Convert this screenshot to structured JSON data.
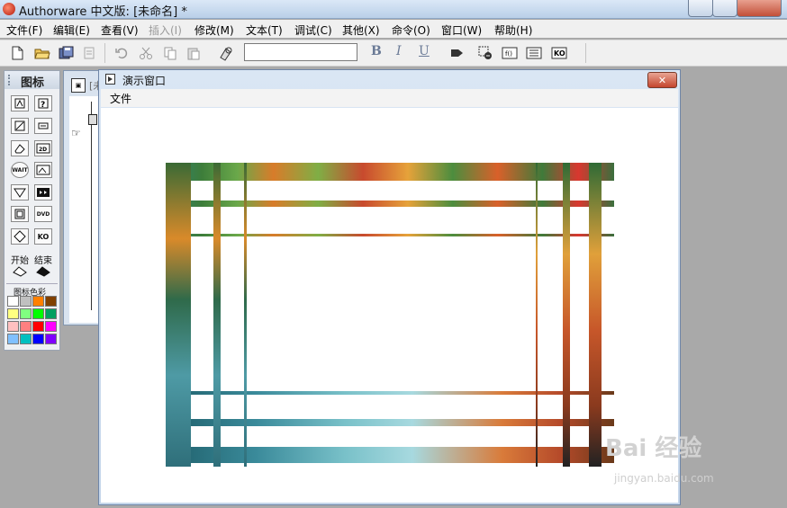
{
  "window": {
    "title": "Authorware 中文版: [未命名] *"
  },
  "menubar": {
    "items": [
      {
        "label": "文件(F)",
        "enabled": true
      },
      {
        "label": "编辑(E)",
        "enabled": true
      },
      {
        "label": "查看(V)",
        "enabled": true
      },
      {
        "label": "插入(I)",
        "enabled": false
      },
      {
        "label": "修改(M)",
        "enabled": true
      },
      {
        "label": "文本(T)",
        "enabled": true
      },
      {
        "label": "调试(C)",
        "enabled": true
      },
      {
        "label": "其他(X)",
        "enabled": true
      },
      {
        "label": "命令(O)",
        "enabled": true
      },
      {
        "label": "窗口(W)",
        "enabled": true
      },
      {
        "label": "帮助(H)",
        "enabled": true
      }
    ]
  },
  "toolbar": {
    "font_combo_value": "",
    "format": {
      "bold": "B",
      "italic": "I",
      "underline": "U"
    }
  },
  "palette": {
    "title": "图标",
    "start_label": "开始",
    "end_label": "结束",
    "color_label": "图标色彩",
    "icons": [
      "display",
      "decision",
      "calculation",
      "map",
      "erase",
      "wait",
      "motion",
      "navigate",
      "framework",
      "interaction",
      "sound",
      "video",
      "branch",
      "knowledge"
    ],
    "icon_text": {
      "wait": "WAIT",
      "dvd": "DVD",
      "ko": "KO"
    },
    "colors": [
      "#ffffff",
      "#c0c0c0",
      "#ff8000",
      "#804000",
      "#ffff80",
      "#80ff80",
      "#00ff00",
      "#00a060",
      "#ffc0c0",
      "#ff8080",
      "#ff0000",
      "#ff00ff",
      "#80c0ff",
      "#00c0c0",
      "#0000ff",
      "#8000ff"
    ]
  },
  "design_window": {
    "title_partial": "[未"
  },
  "presentation": {
    "title": "演示窗口",
    "menu_file": "文件",
    "close_glyph": "✕"
  },
  "watermark": {
    "brand": "Bai 经验",
    "url": "jingyan.baidu.com"
  }
}
